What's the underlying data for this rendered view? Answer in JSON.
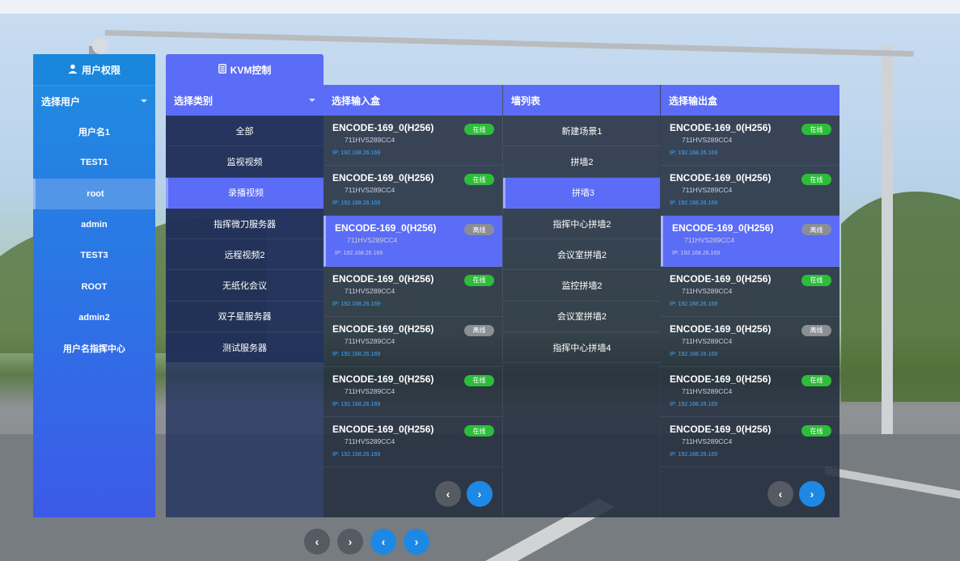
{
  "user_panel": {
    "title": "用户权限",
    "select_label": "选择用户",
    "users": [
      {
        "label": "用户名1",
        "active": false
      },
      {
        "label": "TEST1",
        "active": false
      },
      {
        "label": "root",
        "active": true
      },
      {
        "label": "admin",
        "active": false
      },
      {
        "label": "TEST3",
        "active": false
      },
      {
        "label": "ROOT",
        "active": false
      },
      {
        "label": "admin2",
        "active": false
      },
      {
        "label": "用户名指挥中心",
        "active": false
      }
    ]
  },
  "kvm": {
    "tab_label": "KVM控制",
    "category_label": "选择类别",
    "categories": [
      {
        "label": "全部",
        "active": false
      },
      {
        "label": "监视视频",
        "active": false
      },
      {
        "label": "录播视频",
        "active": true
      },
      {
        "label": "指挥微刀服务器",
        "active": false
      },
      {
        "label": "远程视频2",
        "active": false
      },
      {
        "label": "无纸化会议",
        "active": false
      },
      {
        "label": "双子星服务器",
        "active": false
      },
      {
        "label": "测试服务器",
        "active": false
      }
    ],
    "input_header": "选择输入盒",
    "wall_header": "墙列表",
    "output_header": "选择输出盒",
    "inputs": [
      {
        "name": "ENCODE-169_0(H256)",
        "code": "711HVS289CC4",
        "ip": "IP: 192.168.26.169",
        "status": "在线",
        "online": true,
        "active": false
      },
      {
        "name": "ENCODE-169_0(H256)",
        "code": "711HVS289CC4",
        "ip": "IP: 192.168.26.169",
        "status": "在线",
        "online": true,
        "active": false
      },
      {
        "name": "ENCODE-169_0(H256)",
        "code": "711HVS289CC4",
        "ip": "IP: 192.168.26.169",
        "status": "离线",
        "online": false,
        "active": true
      },
      {
        "name": "ENCODE-169_0(H256)",
        "code": "711HVS289CC4",
        "ip": "IP: 192.168.26.169",
        "status": "在线",
        "online": true,
        "active": false
      },
      {
        "name": "ENCODE-169_0(H256)",
        "code": "711HVS289CC4",
        "ip": "IP: 192.168.26.169",
        "status": "离线",
        "online": false,
        "active": false
      },
      {
        "name": "ENCODE-169_0(H256)",
        "code": "711HVS289CC4",
        "ip": "IP: 192.168.26.169",
        "status": "在线",
        "online": true,
        "active": false
      },
      {
        "name": "ENCODE-169_0(H256)",
        "code": "711HVS289CC4",
        "ip": "IP: 192.168.26.169",
        "status": "在线",
        "online": true,
        "active": false
      }
    ],
    "walls": [
      {
        "label": "新建场景1",
        "active": false
      },
      {
        "label": "拼墙2",
        "active": false
      },
      {
        "label": "拼墙3",
        "active": true
      },
      {
        "label": "指挥中心拼墙2",
        "active": false
      },
      {
        "label": "会议室拼墙2",
        "active": false
      },
      {
        "label": "监控拼墙2",
        "active": false
      },
      {
        "label": "会议室拼墙2",
        "active": false
      },
      {
        "label": "指挥中心拼墙4",
        "active": false
      }
    ],
    "outputs": [
      {
        "name": "ENCODE-169_0(H256)",
        "code": "711HVS289CC4",
        "ip": "IP: 192.168.26.169",
        "status": "在线",
        "online": true,
        "active": false
      },
      {
        "name": "ENCODE-169_0(H256)",
        "code": "711HVS289CC4",
        "ip": "IP: 192.168.26.169",
        "status": "在线",
        "online": true,
        "active": false
      },
      {
        "name": "ENCODE-169_0(H256)",
        "code": "711HVS289CC4",
        "ip": "IP: 192.168.26.169",
        "status": "离线",
        "online": false,
        "active": true
      },
      {
        "name": "ENCODE-169_0(H256)",
        "code": "711HVS289CC4",
        "ip": "IP: 192.168.26.169",
        "status": "在线",
        "online": true,
        "active": false
      },
      {
        "name": "ENCODE-169_0(H256)",
        "code": "711HVS289CC4",
        "ip": "IP: 192.168.26.169",
        "status": "离线",
        "online": false,
        "active": false
      },
      {
        "name": "ENCODE-169_0(H256)",
        "code": "711HVS289CC4",
        "ip": "IP: 192.168.26.169",
        "status": "在线",
        "online": true,
        "active": false
      },
      {
        "name": "ENCODE-169_0(H256)",
        "code": "711HVS289CC4",
        "ip": "IP: 192.168.26.169",
        "status": "在线",
        "online": true,
        "active": false
      }
    ]
  },
  "pager": {
    "prev": "‹",
    "next": "›"
  },
  "icons": {
    "user": "user-icon",
    "kvm": "kvm-icon"
  },
  "colors": {
    "accent": "#5b6cf6",
    "online": "#2ebd3a",
    "offline": "#8b8e96",
    "user_panel": "#1e8de0"
  }
}
